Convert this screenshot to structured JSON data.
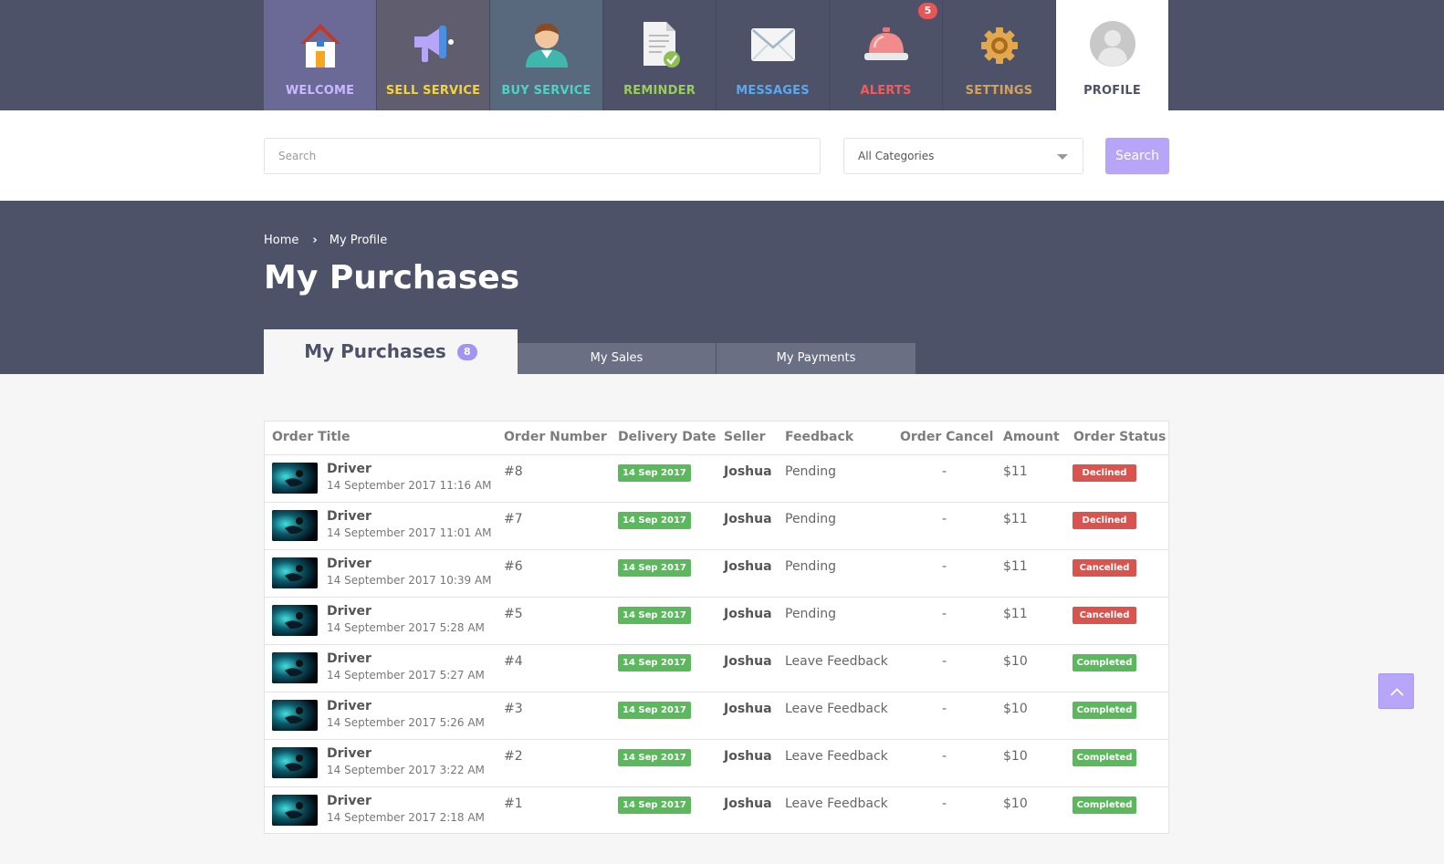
{
  "nav": [
    {
      "label": "WELCOME",
      "icon": "house-icon",
      "bg": "#6b6a96",
      "color": "#c9b8ff"
    },
    {
      "label": "SELL SERVICE",
      "icon": "megaphone-icon",
      "bg": "#5f5d6e",
      "color": "#f5d33f"
    },
    {
      "label": "BUY SERVICE",
      "icon": "user-icon",
      "bg": "#58687d",
      "color": "#4fd1c5"
    },
    {
      "label": "REMINDER",
      "icon": "document-check-icon",
      "bg": "#4d5268",
      "color": "#9acd5a"
    },
    {
      "label": "MESSAGES",
      "icon": "envelope-icon",
      "bg": "#4d5268",
      "color": "#5aa8f0"
    },
    {
      "label": "ALERTS",
      "icon": "bell-icon",
      "bg": "#4d5268",
      "color": "#ef5d5d",
      "badge": "5"
    },
    {
      "label": "SETTINGS",
      "icon": "gear-icon",
      "bg": "#4d5268",
      "color": "#d6a25a"
    },
    {
      "label": "PROFILE",
      "icon": "avatar-icon",
      "bg": "#ffffff",
      "color": "#4d5268"
    }
  ],
  "search": {
    "placeholder": "Search",
    "category": "All Categories",
    "button": "Search"
  },
  "breadcrumb": {
    "home": "Home",
    "current": "My Profile"
  },
  "page_title": "My Purchases",
  "tabs": {
    "active": "My Purchases",
    "active_count": "8",
    "sales": "My Sales",
    "payments": "My Payments"
  },
  "table": {
    "headers": [
      "Order Title",
      "Order Number",
      "Delivery Date",
      "Seller",
      "Feedback",
      "Order Cancel",
      "Amount",
      "Order Status"
    ],
    "rows": [
      {
        "title": "Driver",
        "date": "14 September 2017 11:16 AM",
        "number": "#8",
        "delivery": "14 Sep 2017",
        "seller": "Joshua",
        "feedback": "Pending",
        "cancel": "-",
        "amount": "$11",
        "status": "Declined"
      },
      {
        "title": "Driver",
        "date": "14 September 2017 11:01 AM",
        "number": "#7",
        "delivery": "14 Sep 2017",
        "seller": "Joshua",
        "feedback": "Pending",
        "cancel": "-",
        "amount": "$11",
        "status": "Declined"
      },
      {
        "title": "Driver",
        "date": "14 September 2017 10:39 AM",
        "number": "#6",
        "delivery": "14 Sep 2017",
        "seller": "Joshua",
        "feedback": "Pending",
        "cancel": "-",
        "amount": "$11",
        "status": "Cancelled"
      },
      {
        "title": "Driver",
        "date": "14 September 2017 5:28 AM",
        "number": "#5",
        "delivery": "14 Sep 2017",
        "seller": "Joshua",
        "feedback": "Pending",
        "cancel": "-",
        "amount": "$11",
        "status": "Cancelled"
      },
      {
        "title": "Driver",
        "date": "14 September 2017 5:27 AM",
        "number": "#4",
        "delivery": "14 Sep 2017",
        "seller": "Joshua",
        "feedback": "Leave Feedback",
        "cancel": "-",
        "amount": "$10",
        "status": "Completed"
      },
      {
        "title": "Driver",
        "date": "14 September 2017 5:26 AM",
        "number": "#3",
        "delivery": "14 Sep 2017",
        "seller": "Joshua",
        "feedback": "Leave Feedback",
        "cancel": "-",
        "amount": "$10",
        "status": "Completed"
      },
      {
        "title": "Driver",
        "date": "14 September 2017 3:22 AM",
        "number": "#2",
        "delivery": "14 Sep 2017",
        "seller": "Joshua",
        "feedback": "Leave Feedback",
        "cancel": "-",
        "amount": "$10",
        "status": "Completed"
      },
      {
        "title": "Driver",
        "date": "14 September 2017 2:18 AM",
        "number": "#1",
        "delivery": "14 Sep 2017",
        "seller": "Joshua",
        "feedback": "Leave Feedback",
        "cancel": "-",
        "amount": "$10",
        "status": "Completed"
      }
    ]
  },
  "status_colors": {
    "Declined": "#d9534f",
    "Cancelled": "#d9534f",
    "Completed": "#5cb85c"
  },
  "scroll_top_icon": "chevron-up-icon"
}
